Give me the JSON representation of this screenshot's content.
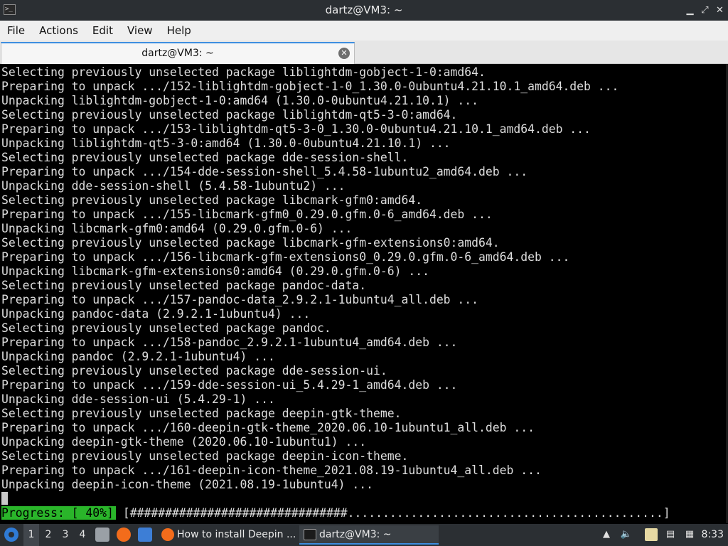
{
  "window": {
    "title": "dartz@VM3: ~",
    "app_icon": ">_",
    "controls": {
      "minimize": "▁",
      "maximize": "⤢",
      "close": "✕"
    }
  },
  "menu": [
    "File",
    "Actions",
    "Edit",
    "View",
    "Help"
  ],
  "tab": {
    "label": "dartz@VM3: ~",
    "close_icon": "close-icon"
  },
  "terminal": {
    "lines": [
      "Selecting previously unselected package liblightdm-gobject-1-0:amd64.",
      "Preparing to unpack .../152-liblightdm-gobject-1-0_1.30.0-0ubuntu4.21.10.1_amd64.deb ...",
      "Unpacking liblightdm-gobject-1-0:amd64 (1.30.0-0ubuntu4.21.10.1) ...",
      "Selecting previously unselected package liblightdm-qt5-3-0:amd64.",
      "Preparing to unpack .../153-liblightdm-qt5-3-0_1.30.0-0ubuntu4.21.10.1_amd64.deb ...",
      "Unpacking liblightdm-qt5-3-0:amd64 (1.30.0-0ubuntu4.21.10.1) ...",
      "Selecting previously unselected package dde-session-shell.",
      "Preparing to unpack .../154-dde-session-shell_5.4.58-1ubuntu2_amd64.deb ...",
      "Unpacking dde-session-shell (5.4.58-1ubuntu2) ...",
      "Selecting previously unselected package libcmark-gfm0:amd64.",
      "Preparing to unpack .../155-libcmark-gfm0_0.29.0.gfm.0-6_amd64.deb ...",
      "Unpacking libcmark-gfm0:amd64 (0.29.0.gfm.0-6) ...",
      "Selecting previously unselected package libcmark-gfm-extensions0:amd64.",
      "Preparing to unpack .../156-libcmark-gfm-extensions0_0.29.0.gfm.0-6_amd64.deb ...",
      "Unpacking libcmark-gfm-extensions0:amd64 (0.29.0.gfm.0-6) ...",
      "Selecting previously unselected package pandoc-data.",
      "Preparing to unpack .../157-pandoc-data_2.9.2.1-1ubuntu4_all.deb ...",
      "Unpacking pandoc-data (2.9.2.1-1ubuntu4) ...",
      "Selecting previously unselected package pandoc.",
      "Preparing to unpack .../158-pandoc_2.9.2.1-1ubuntu4_amd64.deb ...",
      "Unpacking pandoc (2.9.2.1-1ubuntu4) ...",
      "Selecting previously unselected package dde-session-ui.",
      "Preparing to unpack .../159-dde-session-ui_5.4.29-1_amd64.deb ...",
      "Unpacking dde-session-ui (5.4.29-1) ...",
      "Selecting previously unselected package deepin-gtk-theme.",
      "Preparing to unpack .../160-deepin-gtk-theme_2020.06.10-1ubuntu1_all.deb ...",
      "Unpacking deepin-gtk-theme (2020.06.10-1ubuntu1) ...",
      "Selecting previously unselected package deepin-icon-theme.",
      "Preparing to unpack .../161-deepin-icon-theme_2021.08.19-1ubuntu4_all.deb ...",
      "Unpacking deepin-icon-theme (2021.08.19-1ubuntu4) ..."
    ],
    "progress_label": "Progress: [ 40%]",
    "progress_bar": "[###############################.............................................]",
    "progress_fraction": 0.4
  },
  "taskbar": {
    "workspaces": [
      "1",
      "2",
      "3",
      "4"
    ],
    "active_workspace": "1",
    "tasks": [
      {
        "label": "How to install Deepin ...",
        "icon": "firefox-icon"
      },
      {
        "label": "dartz@VM3: ~",
        "icon": "terminal-icon"
      }
    ],
    "clock": "8:33"
  },
  "colors": {
    "titlebar": "#2b2f33",
    "accent": "#3d8ee0",
    "progress_green": "#2ab52a",
    "terminal_text": "#dedede"
  }
}
